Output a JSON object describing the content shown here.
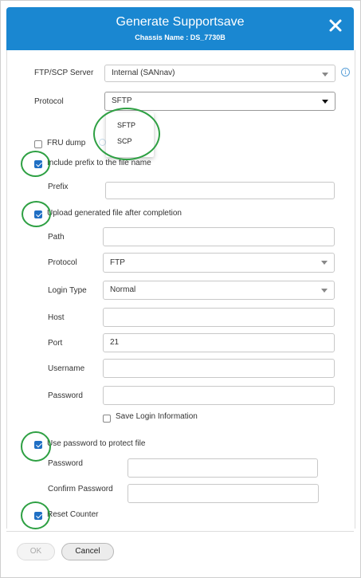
{
  "dialog": {
    "title": "Generate Supportsave",
    "subtitle": "Chassis Name : DS_7730B",
    "close_icon": "close-x-icon"
  },
  "form": {
    "server_label": "FTP/SCP Server",
    "server_value": "Internal (SANnav)",
    "protocol_label": "Protocol",
    "protocol_value": "SFTP",
    "protocol_options": [
      "SFTP",
      "SCP"
    ],
    "fru_dump_label": "FRU dump",
    "fru_dump_checked": false,
    "include_prefix_label": "Include prefix to the file name",
    "include_prefix_checked": true,
    "prefix_label": "Prefix",
    "prefix_value": "",
    "upload_label": "Upload generated file after completion",
    "upload_checked": true,
    "path_label": "Path",
    "path_value": "",
    "upload_protocol_label": "Protocol",
    "upload_protocol_value": "FTP",
    "login_type_label": "Login Type",
    "login_type_value": "Normal",
    "host_label": "Host",
    "host_value": "",
    "port_label": "Port",
    "port_value": "21",
    "username_label": "Username",
    "username_value": "",
    "password_label": "Password",
    "password_value": "",
    "save_login_label": "Save Login Information",
    "save_login_checked": false,
    "use_password_label": "Use password to protect file",
    "use_password_checked": true,
    "protect_password_label": "Password",
    "confirm_password_label": "Confirm Password",
    "reset_counter_label": "Reset Counter",
    "reset_counter_checked": true
  },
  "footer": {
    "ok_label": "OK",
    "cancel_label": "Cancel"
  },
  "colors": {
    "header": "#1a87d1",
    "checkbox_checked": "#1f6fc4",
    "annotation_ring": "#2ea043"
  }
}
